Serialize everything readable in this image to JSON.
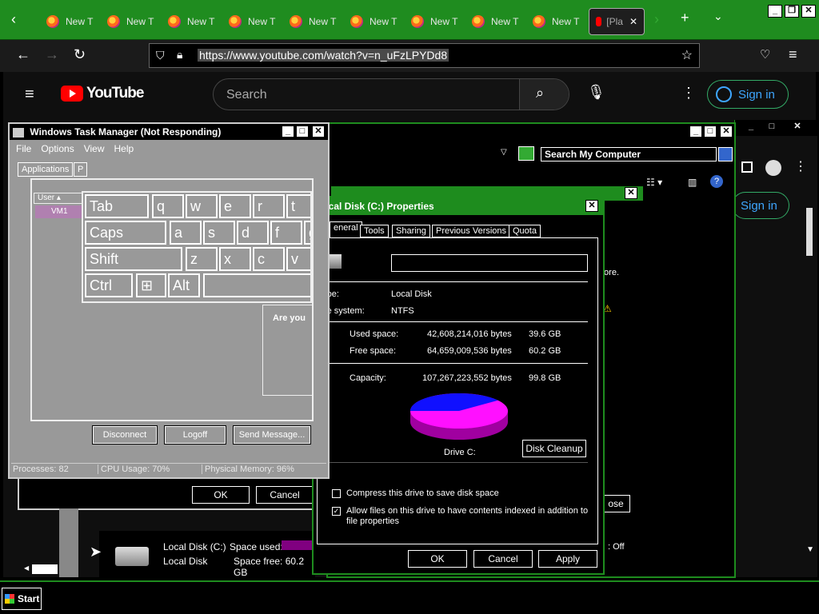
{
  "browser": {
    "tabs": [
      "New T",
      "New T",
      "New T",
      "New T",
      "New T",
      "New T",
      "New T",
      "New T",
      "New T"
    ],
    "active_tab": "[Pla",
    "url": "https://www.youtube.com/watch?v=n_uFzLPYDd8"
  },
  "youtube": {
    "logo_text": "YouTube",
    "search_placeholder": "Search",
    "sign_in": "Sign in",
    "sign_in_2": "Sign in"
  },
  "task_manager": {
    "title": "Windows Task Manager (Not Responding)",
    "menu": [
      "File",
      "Options",
      "View",
      "Help"
    ],
    "tab_applications": "Applications",
    "tab_partial": "P",
    "col_user": "User",
    "user_vm": "VM1",
    "keys": {
      "tab": "Tab",
      "q": "q",
      "w": "w",
      "e": "e",
      "r": "r",
      "t": "t",
      "caps": "Caps",
      "a": "a",
      "s": "s",
      "d": "d",
      "f": "f",
      "g": "g",
      "shift": "Shift",
      "z": "z",
      "x": "x",
      "c": "c",
      "v": "v",
      "ctrl": "Ctrl",
      "alt": "Alt"
    },
    "are_you": "Are you",
    "btn_disconnect": "Disconnect",
    "btn_logoff": "Logoff",
    "btn_send": "Send Message...",
    "status_processes": "Processes: 82",
    "status_cpu": "CPU Usage: 70%",
    "status_memory": "Physical Memory: 96%"
  },
  "my_computer": {
    "search_label": "Search My Computer",
    "fore_text": "fore.",
    "ok": "OK",
    "cancel": "Cancel",
    "close_partial": "ose",
    "drive_name": "Local Disk (C:)",
    "drive_type": "Local Disk",
    "space_used_label": "Space used:",
    "space_free": "Space free: 60.2 GB",
    "off": ": Off"
  },
  "disk_properties": {
    "title": "Local Disk (C:) Properties",
    "tabs": [
      "eneral",
      "Tools",
      "Sharing",
      "Previous Versions",
      "Quota"
    ],
    "type_label": "Type:",
    "type_value": "Local Disk",
    "fs_label": "File system:",
    "fs_value": "NTFS",
    "used_label": "Used space:",
    "used_bytes": "42,608,214,016 bytes",
    "used_gb": "39.6 GB",
    "free_label": "Free space:",
    "free_bytes": "64,659,009,536 bytes",
    "free_gb": "60.2 GB",
    "cap_label": "Capacity:",
    "cap_bytes": "107,267,223,552 bytes",
    "cap_gb": "99.8 GB",
    "drive_label": "Drive C:",
    "disk_cleanup": "Disk Cleanup",
    "compress": "Compress this drive to save disk space",
    "index": "Allow files on this drive to have contents indexed in addition to file properties",
    "ok": "OK",
    "cancel": "Cancel",
    "apply": "Apply",
    "used_fraction": 0.397,
    "colors": {
      "used": "#1010ff",
      "free": "#ff10ff"
    }
  },
  "taskbar": {
    "start": "Start"
  }
}
